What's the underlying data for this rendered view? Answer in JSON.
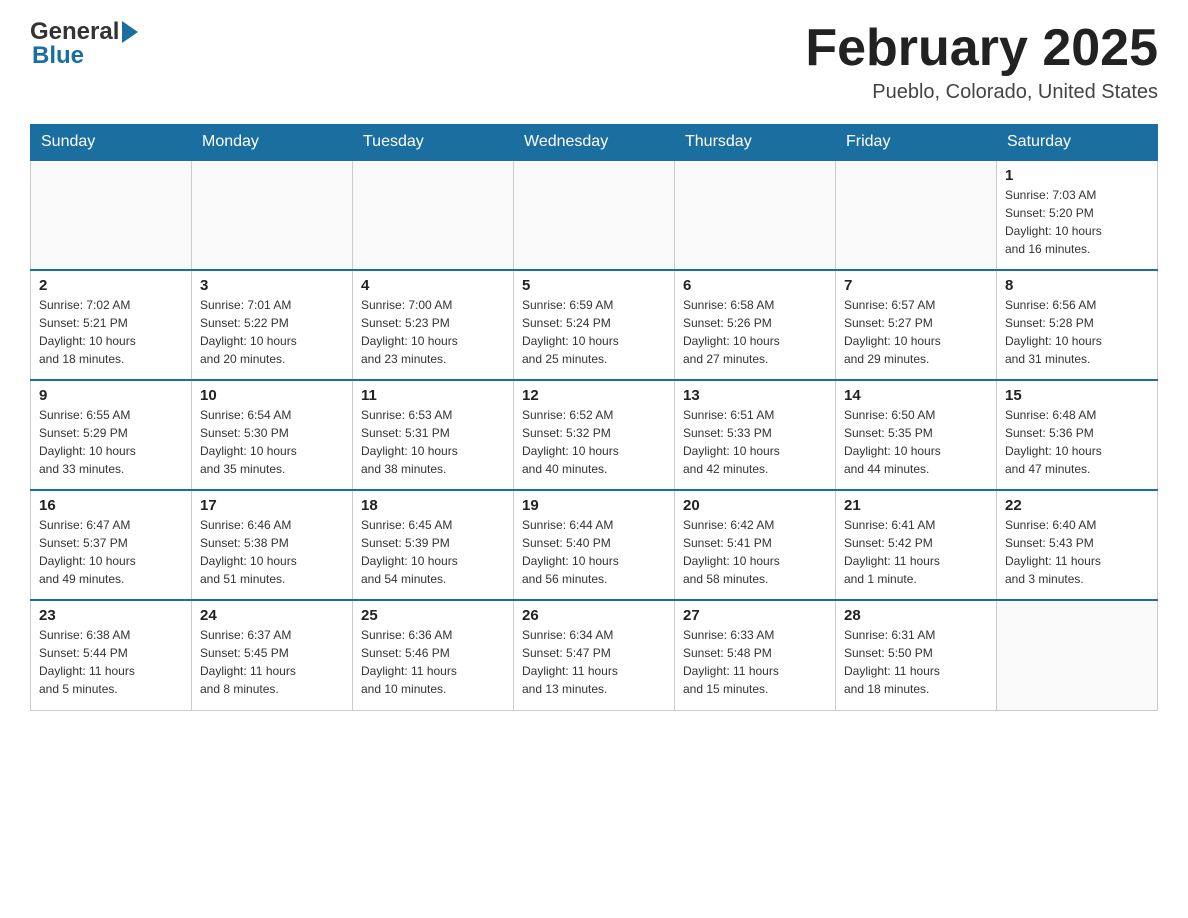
{
  "header": {
    "logo_general": "General",
    "logo_blue": "Blue",
    "month_title": "February 2025",
    "location": "Pueblo, Colorado, United States"
  },
  "weekdays": [
    "Sunday",
    "Monday",
    "Tuesday",
    "Wednesday",
    "Thursday",
    "Friday",
    "Saturday"
  ],
  "weeks": [
    [
      {
        "day": "",
        "info": ""
      },
      {
        "day": "",
        "info": ""
      },
      {
        "day": "",
        "info": ""
      },
      {
        "day": "",
        "info": ""
      },
      {
        "day": "",
        "info": ""
      },
      {
        "day": "",
        "info": ""
      },
      {
        "day": "1",
        "info": "Sunrise: 7:03 AM\nSunset: 5:20 PM\nDaylight: 10 hours\nand 16 minutes."
      }
    ],
    [
      {
        "day": "2",
        "info": "Sunrise: 7:02 AM\nSunset: 5:21 PM\nDaylight: 10 hours\nand 18 minutes."
      },
      {
        "day": "3",
        "info": "Sunrise: 7:01 AM\nSunset: 5:22 PM\nDaylight: 10 hours\nand 20 minutes."
      },
      {
        "day": "4",
        "info": "Sunrise: 7:00 AM\nSunset: 5:23 PM\nDaylight: 10 hours\nand 23 minutes."
      },
      {
        "day": "5",
        "info": "Sunrise: 6:59 AM\nSunset: 5:24 PM\nDaylight: 10 hours\nand 25 minutes."
      },
      {
        "day": "6",
        "info": "Sunrise: 6:58 AM\nSunset: 5:26 PM\nDaylight: 10 hours\nand 27 minutes."
      },
      {
        "day": "7",
        "info": "Sunrise: 6:57 AM\nSunset: 5:27 PM\nDaylight: 10 hours\nand 29 minutes."
      },
      {
        "day": "8",
        "info": "Sunrise: 6:56 AM\nSunset: 5:28 PM\nDaylight: 10 hours\nand 31 minutes."
      }
    ],
    [
      {
        "day": "9",
        "info": "Sunrise: 6:55 AM\nSunset: 5:29 PM\nDaylight: 10 hours\nand 33 minutes."
      },
      {
        "day": "10",
        "info": "Sunrise: 6:54 AM\nSunset: 5:30 PM\nDaylight: 10 hours\nand 35 minutes."
      },
      {
        "day": "11",
        "info": "Sunrise: 6:53 AM\nSunset: 5:31 PM\nDaylight: 10 hours\nand 38 minutes."
      },
      {
        "day": "12",
        "info": "Sunrise: 6:52 AM\nSunset: 5:32 PM\nDaylight: 10 hours\nand 40 minutes."
      },
      {
        "day": "13",
        "info": "Sunrise: 6:51 AM\nSunset: 5:33 PM\nDaylight: 10 hours\nand 42 minutes."
      },
      {
        "day": "14",
        "info": "Sunrise: 6:50 AM\nSunset: 5:35 PM\nDaylight: 10 hours\nand 44 minutes."
      },
      {
        "day": "15",
        "info": "Sunrise: 6:48 AM\nSunset: 5:36 PM\nDaylight: 10 hours\nand 47 minutes."
      }
    ],
    [
      {
        "day": "16",
        "info": "Sunrise: 6:47 AM\nSunset: 5:37 PM\nDaylight: 10 hours\nand 49 minutes."
      },
      {
        "day": "17",
        "info": "Sunrise: 6:46 AM\nSunset: 5:38 PM\nDaylight: 10 hours\nand 51 minutes."
      },
      {
        "day": "18",
        "info": "Sunrise: 6:45 AM\nSunset: 5:39 PM\nDaylight: 10 hours\nand 54 minutes."
      },
      {
        "day": "19",
        "info": "Sunrise: 6:44 AM\nSunset: 5:40 PM\nDaylight: 10 hours\nand 56 minutes."
      },
      {
        "day": "20",
        "info": "Sunrise: 6:42 AM\nSunset: 5:41 PM\nDaylight: 10 hours\nand 58 minutes."
      },
      {
        "day": "21",
        "info": "Sunrise: 6:41 AM\nSunset: 5:42 PM\nDaylight: 11 hours\nand 1 minute."
      },
      {
        "day": "22",
        "info": "Sunrise: 6:40 AM\nSunset: 5:43 PM\nDaylight: 11 hours\nand 3 minutes."
      }
    ],
    [
      {
        "day": "23",
        "info": "Sunrise: 6:38 AM\nSunset: 5:44 PM\nDaylight: 11 hours\nand 5 minutes."
      },
      {
        "day": "24",
        "info": "Sunrise: 6:37 AM\nSunset: 5:45 PM\nDaylight: 11 hours\nand 8 minutes."
      },
      {
        "day": "25",
        "info": "Sunrise: 6:36 AM\nSunset: 5:46 PM\nDaylight: 11 hours\nand 10 minutes."
      },
      {
        "day": "26",
        "info": "Sunrise: 6:34 AM\nSunset: 5:47 PM\nDaylight: 11 hours\nand 13 minutes."
      },
      {
        "day": "27",
        "info": "Sunrise: 6:33 AM\nSunset: 5:48 PM\nDaylight: 11 hours\nand 15 minutes."
      },
      {
        "day": "28",
        "info": "Sunrise: 6:31 AM\nSunset: 5:50 PM\nDaylight: 11 hours\nand 18 minutes."
      },
      {
        "day": "",
        "info": ""
      }
    ]
  ]
}
